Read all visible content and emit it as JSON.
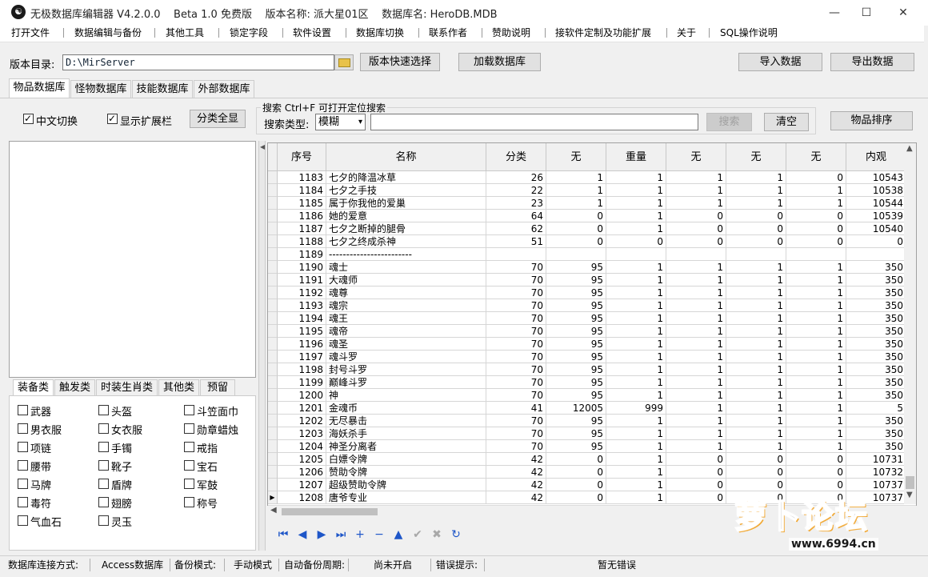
{
  "window": {
    "title": "无极数据库编辑器 V4.2.0.0    Beta 1.0 免费版    版本名称: 派大星01区    数据库名: HeroDB.MDB",
    "app_icon_glyph": "☯",
    "minimize_glyph": "—",
    "maximize_glyph": "☐",
    "close_glyph": "✕"
  },
  "menu": [
    "打开文件",
    "数据编辑与备份",
    "其他工具",
    "锁定字段",
    "软件设置",
    "数据库切换",
    "联系作者",
    "赞助说明",
    "接软件定制及功能扩展",
    "关于",
    "SQL操作说明"
  ],
  "toolbar": {
    "version_dir_label": "版本目录:",
    "version_dir_value": "D:\\MirServer",
    "folder_icon": "folder-icon",
    "quick_select_button": "版本快速选择",
    "load_db_button": "加载数据库",
    "import_button": "导入数据",
    "export_button": "导出数据"
  },
  "db_tabs": [
    "物品数据库",
    "怪物数据库",
    "技能数据库",
    "外部数据库"
  ],
  "options": {
    "chinese_switch": "中文切换",
    "chinese_switch_checked": true,
    "show_ext": "显示扩展栏",
    "show_ext_checked": true,
    "show_all_button": "分类全显"
  },
  "search": {
    "group_label": "搜索   Ctrl+F 可打开定位搜索",
    "type_label": "搜索类型:",
    "type_value": "模糊",
    "query_value": "",
    "search_button": "搜索",
    "clear_button": "清空",
    "sort_button": "物品排序"
  },
  "category_tabs": [
    "装备类",
    "触发类",
    "时装生肖类",
    "其他类",
    "预留"
  ],
  "categories": [
    [
      "武器",
      "头盔",
      "斗笠面巾"
    ],
    [
      "男衣服",
      "女衣服",
      "勋章蜡烛"
    ],
    [
      "项链",
      "手镯",
      "戒指"
    ],
    [
      "腰带",
      "靴子",
      "宝石"
    ],
    [
      "马牌",
      "盾牌",
      "军鼓"
    ],
    [
      "毒符",
      "翅膀",
      "称号"
    ],
    [
      "气血石",
      "灵玉",
      ""
    ]
  ],
  "grid": {
    "headers": [
      "序号",
      "名称",
      "分类",
      "无",
      "重量",
      "无",
      "无",
      "无",
      "内观"
    ],
    "rows": [
      [
        "1183",
        "七夕的降温冰草",
        "26",
        "1",
        "1",
        "1",
        "1",
        "0",
        "10543"
      ],
      [
        "1184",
        "七夕之手技",
        "22",
        "1",
        "1",
        "1",
        "1",
        "1",
        "10538"
      ],
      [
        "1185",
        "属于你我他的爱巢",
        "23",
        "1",
        "1",
        "1",
        "1",
        "1",
        "10544"
      ],
      [
        "1186",
        "她的爱意",
        "64",
        "0",
        "1",
        "0",
        "0",
        "0",
        "10539"
      ],
      [
        "1187",
        "七夕之断掉的腿骨",
        "62",
        "0",
        "1",
        "0",
        "0",
        "0",
        "10540"
      ],
      [
        "1188",
        "七夕之终成杀神",
        "51",
        "0",
        "0",
        "0",
        "0",
        "0",
        "0"
      ],
      [
        "1189",
        "------------------------",
        "",
        "",
        "",
        "",
        "",
        "",
        ""
      ],
      [
        "1190",
        "魂士",
        "70",
        "95",
        "1",
        "1",
        "1",
        "1",
        "350"
      ],
      [
        "1191",
        "大魂师",
        "70",
        "95",
        "1",
        "1",
        "1",
        "1",
        "350"
      ],
      [
        "1192",
        "魂尊",
        "70",
        "95",
        "1",
        "1",
        "1",
        "1",
        "350"
      ],
      [
        "1193",
        "魂宗",
        "70",
        "95",
        "1",
        "1",
        "1",
        "1",
        "350"
      ],
      [
        "1194",
        "魂王",
        "70",
        "95",
        "1",
        "1",
        "1",
        "1",
        "350"
      ],
      [
        "1195",
        "魂帝",
        "70",
        "95",
        "1",
        "1",
        "1",
        "1",
        "350"
      ],
      [
        "1196",
        "魂圣",
        "70",
        "95",
        "1",
        "1",
        "1",
        "1",
        "350"
      ],
      [
        "1197",
        "魂斗罗",
        "70",
        "95",
        "1",
        "1",
        "1",
        "1",
        "350"
      ],
      [
        "1198",
        "封号斗罗",
        "70",
        "95",
        "1",
        "1",
        "1",
        "1",
        "350"
      ],
      [
        "1199",
        "巅峰斗罗",
        "70",
        "95",
        "1",
        "1",
        "1",
        "1",
        "350"
      ],
      [
        "1200",
        "神",
        "70",
        "95",
        "1",
        "1",
        "1",
        "1",
        "350"
      ],
      [
        "1201",
        "金魂币",
        "41",
        "12005",
        "999",
        "1",
        "1",
        "1",
        "5"
      ],
      [
        "1202",
        "无尽暴击",
        "70",
        "95",
        "1",
        "1",
        "1",
        "1",
        "350"
      ],
      [
        "1203",
        "海妖杀手",
        "70",
        "95",
        "1",
        "1",
        "1",
        "1",
        "350"
      ],
      [
        "1204",
        "神圣分离者",
        "70",
        "95",
        "1",
        "1",
        "1",
        "1",
        "350"
      ],
      [
        "1205",
        "白嫖令牌",
        "42",
        "0",
        "1",
        "0",
        "0",
        "0",
        "10731"
      ],
      [
        "1206",
        "赞助令牌",
        "42",
        "0",
        "1",
        "0",
        "0",
        "0",
        "10732"
      ],
      [
        "1207",
        "超级赞助令牌",
        "42",
        "0",
        "1",
        "0",
        "0",
        "0",
        "10737"
      ],
      [
        "1208",
        "唐爷专业",
        "42",
        "0",
        "1",
        "0",
        "0",
        "0",
        "10737"
      ]
    ],
    "current_row_marker": "▶"
  },
  "nav": [
    {
      "name": "first-record-icon",
      "glyph": "⏮",
      "enabled": true
    },
    {
      "name": "prior-record-icon",
      "glyph": "◀",
      "enabled": true
    },
    {
      "name": "next-record-icon",
      "glyph": "▶",
      "enabled": true
    },
    {
      "name": "last-record-icon",
      "glyph": "⏭",
      "enabled": true
    },
    {
      "name": "insert-record-icon",
      "glyph": "+",
      "enabled": true
    },
    {
      "name": "delete-record-icon",
      "glyph": "−",
      "enabled": true
    },
    {
      "name": "edit-record-icon",
      "glyph": "▲",
      "enabled": true
    },
    {
      "name": "post-record-icon",
      "glyph": "✔",
      "enabled": false
    },
    {
      "name": "cancel-edit-icon",
      "glyph": "✖",
      "enabled": false
    },
    {
      "name": "refresh-icon",
      "glyph": "↻",
      "enabled": true
    }
  ],
  "status": {
    "conn_label": "数据库连接方式:",
    "conn_value": "Access数据库",
    "backup_mode_label": "备份模式:",
    "backup_mode_value": "手动模式",
    "auto_backup_label": "自动备份周期:",
    "auto_backup_value": "尚未开启",
    "error_label": "错误提示:",
    "error_value": "暂无错误"
  },
  "watermark": {
    "text": "萝卜论坛",
    "url": "www.6994.cn"
  },
  "colors": {
    "nav_blue": "#1e56c8",
    "watermark_orange": "#f0a020",
    "watermark_text": "#1a1a1a"
  }
}
